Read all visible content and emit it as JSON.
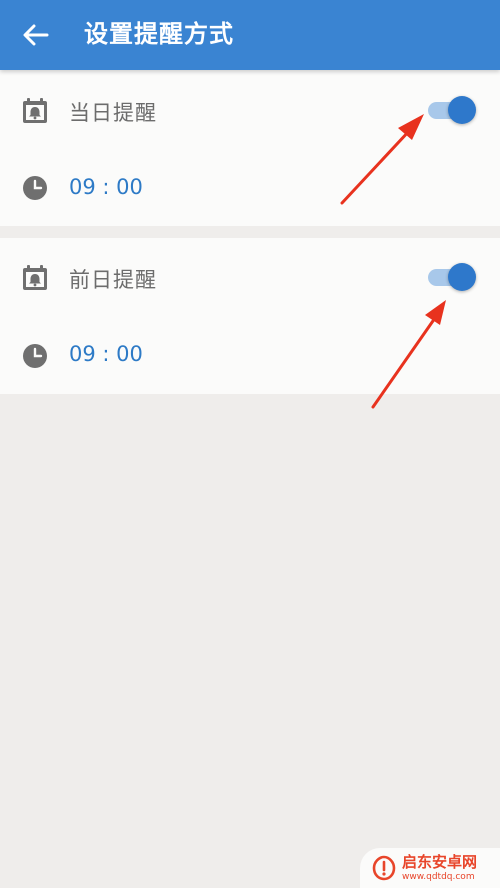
{
  "app_bar": {
    "title": "设置提醒方式",
    "back_icon": "arrow-left-icon"
  },
  "reminders": [
    {
      "label": "当日提醒",
      "time": "09 : 00",
      "enabled": true,
      "label_icon": "calendar-bell-icon",
      "time_icon": "clock-icon"
    },
    {
      "label": "前日提醒",
      "time": "09 : 00",
      "enabled": true,
      "label_icon": "calendar-bell-icon",
      "time_icon": "clock-icon"
    }
  ],
  "watermark": {
    "name": "启东安卓网",
    "url": "www.qdtdq.com"
  },
  "colors": {
    "app_bar": "#3a84d2",
    "accent": "#2e78cb",
    "track": "#a8c8ea",
    "label": "#6c6c6c",
    "time": "#2d7ac6",
    "annotation_arrow": "#e8321e",
    "background": "#efedeb"
  }
}
